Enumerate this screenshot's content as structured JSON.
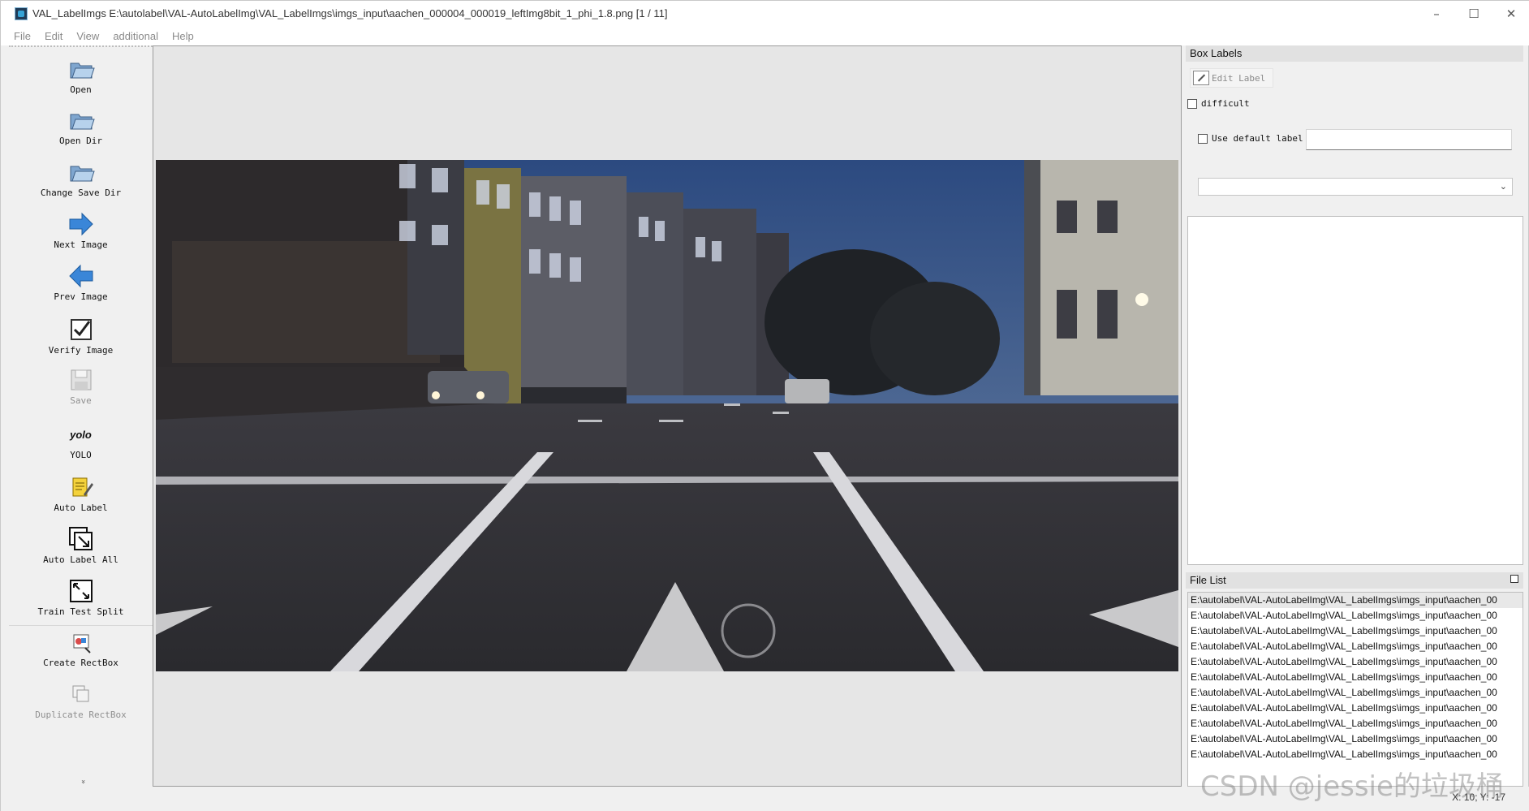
{
  "window": {
    "title": "VAL_LabelImgs E:\\autolabel\\VAL-AutoLabelImg\\VAL_LabelImgs\\imgs_input\\aachen_000004_000019_leftImg8bit_1_phi_1.8.png [1 / 11]",
    "minimize": "–",
    "maximize": "☐",
    "close": "✕"
  },
  "menu": [
    "File",
    "Edit",
    "View",
    "additional",
    "Help"
  ],
  "toolbar": {
    "open": "Open",
    "open_dir": "Open Dir",
    "change_save_dir": "Change Save Dir",
    "next_image": "Next Image",
    "prev_image": "Prev Image",
    "verify_image": "Verify Image",
    "save": "Save",
    "yolo_icon_text": "yolo",
    "yolo": "YOLO",
    "auto_label": "Auto Label",
    "auto_label_all": "Auto Label All",
    "train_test_split": "Train Test Split",
    "create_rectbox": "Create RectBox",
    "duplicate_rectbox": "Duplicate RectBox",
    "more": "»"
  },
  "box_labels": {
    "title": "Box Labels",
    "edit_label": "Edit Label",
    "difficult": "difficult",
    "use_default_label": "Use default label",
    "default_label_value": "",
    "combo_value": ""
  },
  "file_list": {
    "title": "File List",
    "items": [
      "E:\\autolabel\\VAL-AutoLabelImg\\VAL_LabelImgs\\imgs_input\\aachen_00",
      "E:\\autolabel\\VAL-AutoLabelImg\\VAL_LabelImgs\\imgs_input\\aachen_00",
      "E:\\autolabel\\VAL-AutoLabelImg\\VAL_LabelImgs\\imgs_input\\aachen_00",
      "E:\\autolabel\\VAL-AutoLabelImg\\VAL_LabelImgs\\imgs_input\\aachen_00",
      "E:\\autolabel\\VAL-AutoLabelImg\\VAL_LabelImgs\\imgs_input\\aachen_00",
      "E:\\autolabel\\VAL-AutoLabelImg\\VAL_LabelImgs\\imgs_input\\aachen_00",
      "E:\\autolabel\\VAL-AutoLabelImg\\VAL_LabelImgs\\imgs_input\\aachen_00",
      "E:\\autolabel\\VAL-AutoLabelImg\\VAL_LabelImgs\\imgs_input\\aachen_00",
      "E:\\autolabel\\VAL-AutoLabelImg\\VAL_LabelImgs\\imgs_input\\aachen_00",
      "E:\\autolabel\\VAL-AutoLabelImg\\VAL_LabelImgs\\imgs_input\\aachen_00",
      "E:\\autolabel\\VAL-AutoLabelImg\\VAL_LabelImgs\\imgs_input\\aachen_00"
    ]
  },
  "status": {
    "coords": "X: 10; Y: -17"
  },
  "watermark": "CSDN @jessie的垃圾桶",
  "colors": {
    "accent_blue": "#3a86d8",
    "toolbar_bg": "#f0f0f0",
    "canvas_bg": "#e6e6e6"
  }
}
